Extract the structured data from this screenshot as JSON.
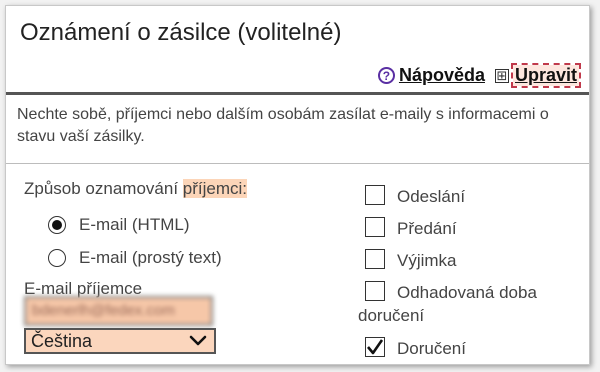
{
  "title": "Oznámení o zásilce (volitelné)",
  "toolbar": {
    "help_icon": "?",
    "help_label": "Nápověda",
    "edit_icon": "⊞",
    "edit_label": "Upravit"
  },
  "description": "Nechte sobě, příjemci nebo dalším osobám zasílat e-maily s informacemi o stavu vaší zásilky.",
  "method": {
    "label_prefix": "Způsob oznamování ",
    "label_highlight": "příjemci:",
    "options": [
      {
        "label": "E-mail (HTML)",
        "selected": true
      },
      {
        "label": "E-mail (prostý text)",
        "selected": false
      }
    ]
  },
  "recipient_email": {
    "label": "E-mail příjemce",
    "value": "bdenerlh@fedex.com"
  },
  "language": {
    "selected": "Čeština"
  },
  "events": [
    {
      "label": "Odeslání",
      "checked": false
    },
    {
      "label": "Předání",
      "checked": false
    },
    {
      "label": "Výjimka",
      "checked": false
    },
    {
      "label_line1": "Odhadovaná doba",
      "label_line2": "doručení",
      "checked": false
    },
    {
      "label": "Doručení",
      "checked": true
    }
  ],
  "colors": {
    "highlight": "#fcd5b8",
    "help_icon": "#5a2fa3",
    "edit_outline": "#c0394b"
  }
}
